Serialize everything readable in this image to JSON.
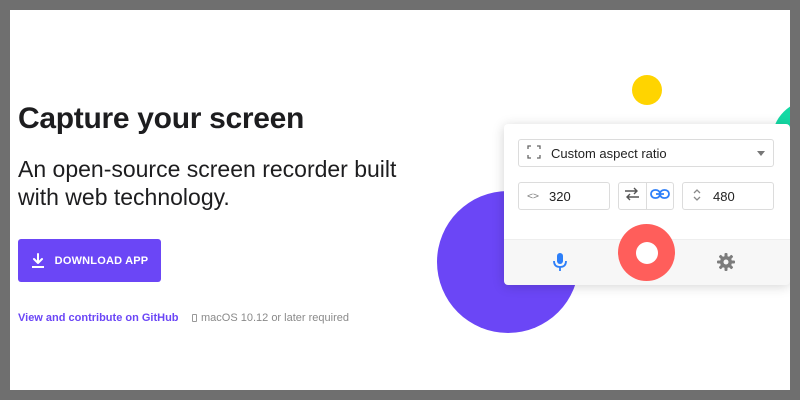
{
  "hero": {
    "title": "Capture your screen",
    "subtitle": "An open-source screen recorder built with web technology.",
    "download_label": "DOWNLOAD APP",
    "github_link": "View and contribute on GitHub",
    "requirement": "macOS 10.12 or later required"
  },
  "cropper": {
    "aspect_ratio": "Custom aspect ratio",
    "width_value": "320",
    "height_value": "480"
  },
  "colors": {
    "accent": "#6b46f6",
    "record": "#ff5e5b",
    "yellow": "#ffd400",
    "green": "#14d9a4",
    "link_blue": "#2d7ff9"
  },
  "icons": [
    "download-icon",
    "apple-icon",
    "crop-icon",
    "chevron-down-icon",
    "code-arrows-icon",
    "swap-icon",
    "link-icon",
    "vertical-arrows-icon",
    "microphone-icon",
    "record-icon",
    "gear-icon"
  ]
}
